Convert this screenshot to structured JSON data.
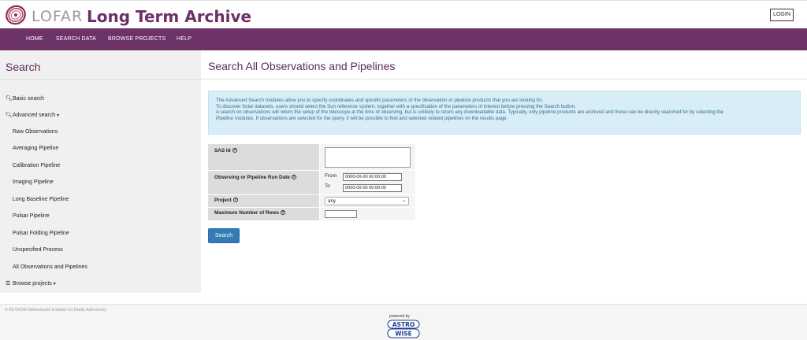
{
  "header": {
    "brand": "LOFAR",
    "app_title": "Long Term Archive",
    "login_label": "LOGIN",
    "logo_icon": "lofar-swirl-icon"
  },
  "nav": {
    "items": [
      "HOME",
      "SEARCH DATA",
      "BROWSE PROJECTS",
      "HELP"
    ]
  },
  "sidebar": {
    "title": "Search",
    "basic_search": "Basic search",
    "advanced_search": "Advanced search",
    "items": [
      "Raw Observations",
      "Averaging Pipeline",
      "Calibration Pipeline",
      "Imaging Pipeline",
      "Long Baseline Pipeline",
      "Pulsar Pipeline",
      "Pulsar Folding Pipeline",
      "Unspecified Process",
      "All Observations and Pipelines"
    ],
    "browse_projects": "Browse projects"
  },
  "main": {
    "title": "Search All Observations and Pipelines",
    "info": [
      "The Advanced Search modules allow you to specify coordinates and specific parameters of the observation or pipeline products that you are looking for.",
      "To discover Solar datasets, users should select the Sun reference system, together with a specification of the parameters of interest before pressing the Search button.",
      "A search on observations will return the setup of the telescope at the time of observing, but is unlikely to return any downloadable data. Typically, only pipeline products are archived and these can be directly searched for by selecting the",
      "Pipeline modules. If observations are selected for the query, it will be possible to find and selected related pipelines on the results page."
    ],
    "form": {
      "sas_id_label": "SAS Id",
      "date_label": "Observing or Pipeline Run Date",
      "from_label": "From",
      "to_label": "To",
      "from_value": "0000-00-00 00:00:00",
      "to_value": "0000-00-00 00:00:00",
      "project_label": "Project",
      "project_value": "any",
      "max_rows_label": "Maximum Number of Rows",
      "help_glyph": "?"
    },
    "search_button": "Search"
  },
  "footer": {
    "copyright": "© ASTRON Netherlands Institute for Radio Astronomy",
    "powered_by": "powered by",
    "aw_line1": "ASTRO",
    "aw_line2": "WISE"
  },
  "colors": {
    "brand_purple": "#6d3368",
    "title_purple": "#5c2a59",
    "info_bg": "#d9edf7",
    "info_text": "#31708f",
    "button_blue": "#337ab7"
  }
}
